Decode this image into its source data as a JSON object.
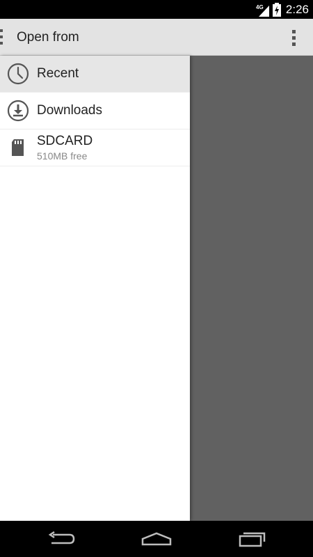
{
  "status_bar": {
    "network": "4G",
    "time": "2:26"
  },
  "action_bar": {
    "title": "Open from"
  },
  "drawer": {
    "items": [
      {
        "label": "Recent",
        "icon": "clock-icon",
        "selected": true
      },
      {
        "label": "Downloads",
        "icon": "download-icon",
        "selected": false
      },
      {
        "label": "SDCARD",
        "sublabel": "510MB free",
        "icon": "sdcard-icon",
        "selected": false
      }
    ]
  },
  "nav_bar": {
    "buttons": [
      "back-icon",
      "home-icon",
      "recent-apps-icon"
    ]
  },
  "colors": {
    "action_bar": "#e3e3e3",
    "drawer_bg": "#ffffff",
    "selected_item": "#e6e6e6",
    "scrim": "#616161"
  }
}
